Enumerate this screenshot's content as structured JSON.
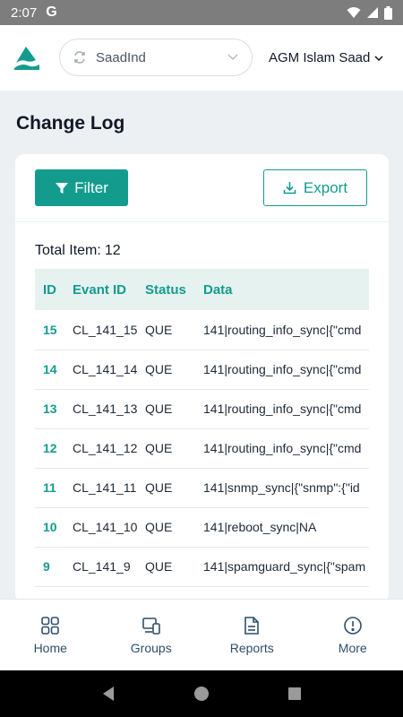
{
  "status_bar": {
    "time": "2:07",
    "g_glyph": "G"
  },
  "header": {
    "org_selector": {
      "value": "SaadInd",
      "icon": "sync-icon"
    },
    "user_name": "AGM Islam Saad"
  },
  "page": {
    "title": "Change Log"
  },
  "toolbar": {
    "filter_label": "Filter",
    "export_label": "Export"
  },
  "total": {
    "label": "Total Item:",
    "count": "12"
  },
  "table": {
    "columns": [
      "ID",
      "Evant ID",
      "Status",
      "Data"
    ],
    "rows": [
      {
        "id": "15",
        "event_id": "CL_141_15",
        "status": "QUE",
        "data": "141|routing_info_sync|{\"cmd"
      },
      {
        "id": "14",
        "event_id": "CL_141_14",
        "status": "QUE",
        "data": "141|routing_info_sync|{\"cmd"
      },
      {
        "id": "13",
        "event_id": "CL_141_13",
        "status": "QUE",
        "data": "141|routing_info_sync|{\"cmd"
      },
      {
        "id": "12",
        "event_id": "CL_141_12",
        "status": "QUE",
        "data": "141|routing_info_sync|{\"cmd"
      },
      {
        "id": "11",
        "event_id": "CL_141_11",
        "status": "QUE",
        "data": "141|snmp_sync|{\"snmp\":{\"id"
      },
      {
        "id": "10",
        "event_id": "CL_141_10",
        "status": "QUE",
        "data": "141|reboot_sync|NA"
      },
      {
        "id": "9",
        "event_id": "CL_141_9",
        "status": "QUE",
        "data": "141|spamguard_sync|{\"spam"
      }
    ]
  },
  "bottom_nav": [
    {
      "label": "Home",
      "icon": "grid-icon"
    },
    {
      "label": "Groups",
      "icon": "devices-icon"
    },
    {
      "label": "Reports",
      "icon": "document-icon"
    },
    {
      "label": "More",
      "icon": "more-circle-icon"
    }
  ],
  "colors": {
    "accent": "#139c8e",
    "page_bg": "#edf0f3",
    "status_bar": "#7d7d7d"
  }
}
